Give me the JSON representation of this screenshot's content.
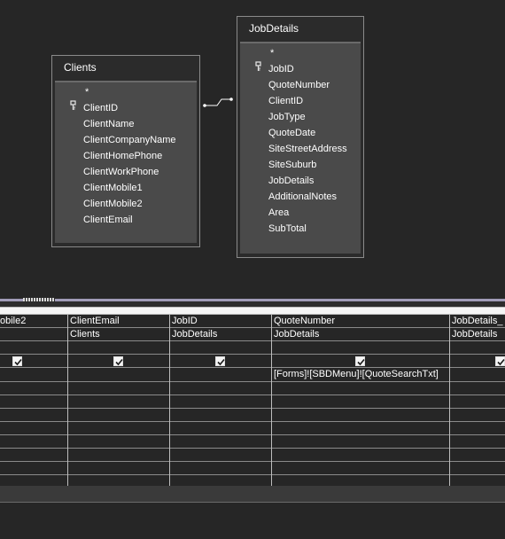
{
  "tables": {
    "clients": {
      "title": "Clients",
      "star": "*",
      "fields": [
        "ClientID",
        "ClientName",
        "ClientCompanyName",
        "ClientHomePhone",
        "ClientWorkPhone",
        "ClientMobile1",
        "ClientMobile2",
        "ClientEmail"
      ],
      "key_field_index": 0
    },
    "jobdetails": {
      "title": "JobDetails",
      "star": "*",
      "fields": [
        "JobID",
        "QuoteNumber",
        "ClientID",
        "JobType",
        "QuoteDate",
        "SiteStreetAddress",
        "SiteSuburb",
        "JobDetails",
        "AdditionalNotes",
        "Area",
        "SubTotal"
      ],
      "key_field_index": 0
    }
  },
  "grid": {
    "columns": [
      {
        "field": "obile2",
        "table": "",
        "show": true,
        "criteria": ""
      },
      {
        "field": "ClientEmail",
        "table": "Clients",
        "show": true,
        "criteria": ""
      },
      {
        "field": "JobID",
        "table": "JobDetails",
        "show": true,
        "criteria": ""
      },
      {
        "field": "QuoteNumber",
        "table": "JobDetails",
        "show": true,
        "criteria": "[Forms]![SBDMenu]![QuoteSearchTxt]"
      },
      {
        "field": "JobDetails_",
        "table": "JobDetails",
        "show": true,
        "criteria": ""
      }
    ]
  },
  "colors": {
    "background": "#262626",
    "field_list": "#4a4a4a",
    "accent_band": "#a09cb8"
  }
}
